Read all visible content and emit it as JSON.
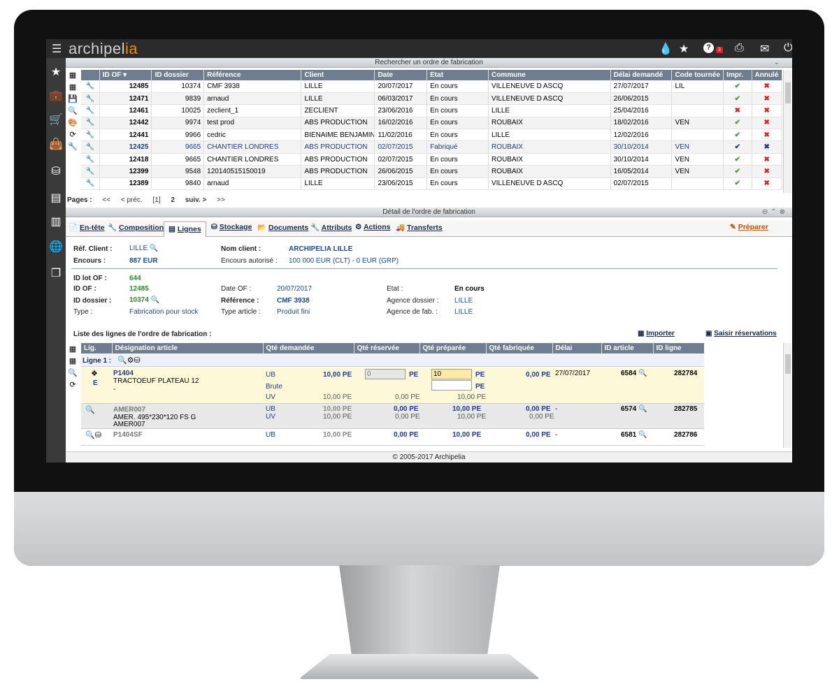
{
  "app": {
    "logo_a": "archipel",
    "logo_b": "ia",
    "badge": "3"
  },
  "search": {
    "title": "Rechercher un ordre de fabrication",
    "columns": [
      "ID OF ▾",
      "ID dossier",
      "Référence",
      "Client",
      "Date",
      "Etat",
      "Commune",
      "Délai demandé",
      "Code tournée",
      "Impr.",
      "Annulé"
    ],
    "rows": [
      [
        "12485",
        "10374",
        "CMF 3938",
        "LILLE",
        "20/07/2017",
        "En cours",
        "VILLENEUVE D ASCQ",
        "27/07/2017",
        "LIL",
        "✔",
        "✖"
      ],
      [
        "12471",
        "9839",
        "arnaud",
        "LILLE",
        "06/03/2017",
        "En cours",
        "VILLENEUVE D ASCQ",
        "26/06/2015",
        "",
        "✔",
        "✖"
      ],
      [
        "12461",
        "10025",
        "zeclient_1",
        "ZECLIENT",
        "23/06/2016",
        "En cours",
        "LILLE",
        "25/04/2016",
        "",
        "✖",
        "✖"
      ],
      [
        "12442",
        "9974",
        "test prod",
        "ABS PRODUCTION",
        "16/02/2016",
        "En cours",
        "ROUBAIX",
        "18/02/2016",
        "VEN",
        "✔",
        "✖"
      ],
      [
        "12441",
        "9966",
        "cedric",
        "BIENAIME BENJAMIN",
        "11/02/2016",
        "En cours",
        "LILLE",
        "12/02/2016",
        "",
        "✔",
        "✖"
      ],
      [
        "12425",
        "9665",
        "CHANTIER LONDRES",
        "ABS PRODUCTION",
        "02/07/2015",
        "Fabriqué",
        "ROUBAIX",
        "30/10/2014",
        "VEN",
        "✔",
        "✖"
      ],
      [
        "12418",
        "9665",
        "CHANTIER LONDRES",
        "ABS PRODUCTION",
        "02/07/2015",
        "En cours",
        "ROUBAIX",
        "30/10/2014",
        "VEN",
        "✔",
        "✖"
      ],
      [
        "12399",
        "9548",
        "120140515150019",
        "ABS PRODUCTION",
        "26/06/2015",
        "En cours",
        "ROUBAIX",
        "16/05/2014",
        "VEN",
        "✔",
        "✖"
      ],
      [
        "12389",
        "9840",
        "arnaud",
        "LILLE",
        "23/06/2015",
        "En cours",
        "VILLENEUVE D ASCQ",
        "02/07/2015",
        "",
        "✔",
        "✖"
      ]
    ]
  },
  "pager": {
    "label": "Pages :",
    "first": "<<",
    "prev": "< préc.",
    "current": "[1]",
    "p2": "2",
    "next": "suiv. >",
    "last": ">>"
  },
  "detail": {
    "title": "Détail de l'ordre de fabrication",
    "tabs": [
      "En-tête",
      "Composition",
      "Lignes",
      "Stockage",
      "Documents",
      "Attributs",
      "Actions",
      "Transferts"
    ],
    "prepare": "Préparer",
    "ref_client_l": "Réf. Client :",
    "ref_client_v": "LILLE",
    "nom_client_l": "Nom client :",
    "nom_client_v": "ARCHIPELIA LILLE",
    "encours_l": "Encours :",
    "encours_v": "887 EUR",
    "encours_aut_l": "Encours autorisé :",
    "encours_aut_v": "100 000 EUR (CLT)   -   0 EUR (GRP)",
    "idlot_l": "ID lot OF :",
    "idlot_v": "644",
    "idof_l": "ID OF :",
    "idof_v": "12485",
    "iddos_l": "ID dossier :",
    "iddos_v": "10374",
    "type_l": "Type :",
    "type_v": "Fabrication pour stock",
    "date_l": "Date OF :",
    "date_v": "20/07/2017",
    "ref_l": "Référence :",
    "ref_v": "CMF 3938",
    "typeart_l": "Type article :",
    "typeart_v": "Produit fini",
    "etat_l": "Etat :",
    "etat_v": "En cours",
    "agdos_l": "Agence dossier :",
    "agdos_v": "LILLE",
    "agfab_l": "Agence de fab. :",
    "agfab_v": "LILLE",
    "list_title": "Liste des lignes de l'ordre de fabrication :",
    "import": "Importer",
    "saisir": "Saisir réservations"
  },
  "lines": {
    "columns": [
      "Lig.",
      "Désignation article",
      "Qté demandée",
      "Qté réservée",
      "Qté préparée",
      "Qté fabriquée",
      "Délai",
      "ID article",
      "ID ligne"
    ],
    "group": "Ligne 1 :",
    "l1": {
      "code": "P1404",
      "name": "TRACTOEUF PLATEAU 12",
      "dash": "-",
      "flag": "E",
      "ub": "UB",
      "brute": "Brute",
      "uv": "UV",
      "qd": "10,00 PE",
      "qr": "0",
      "qr_unit": "PE",
      "qp": "10",
      "qp_unit": "PE",
      "qp_unit2": "PE",
      "qf": "0,00 PE",
      "delai": "27/07/2017",
      "idart": "6584",
      "idl": "282784",
      "uv_qd": "10,00 PE",
      "uv_qr": "0,00 PE",
      "uv_qp": "10,00 PE"
    },
    "l2": {
      "code": "AMER007",
      "name": "AMER. 495*230*120 FS G",
      "sub": "AMER007",
      "ub": "UB",
      "uv": "UV",
      "qd": "10,00 PE",
      "qd2": "10,00 PE",
      "qr": "0,00 PE",
      "qr2": "0,00 PE",
      "qp": "10,00 PE",
      "qp2": "10,00 PE",
      "qf": "0,00 PE",
      "qf2": "0,00 PE",
      "delai": "-",
      "idart": "6574",
      "idl": "282785"
    },
    "l3": {
      "code": "P1404SF",
      "ub": "UB",
      "qd": "10,00 PE",
      "qr": "0,00 PE",
      "qp": "10,00 PE",
      "qf": "0,00 PE",
      "delai": "-",
      "idart": "6581",
      "idl": "282786"
    }
  },
  "footer": "© 2005-2017 Archipelia"
}
